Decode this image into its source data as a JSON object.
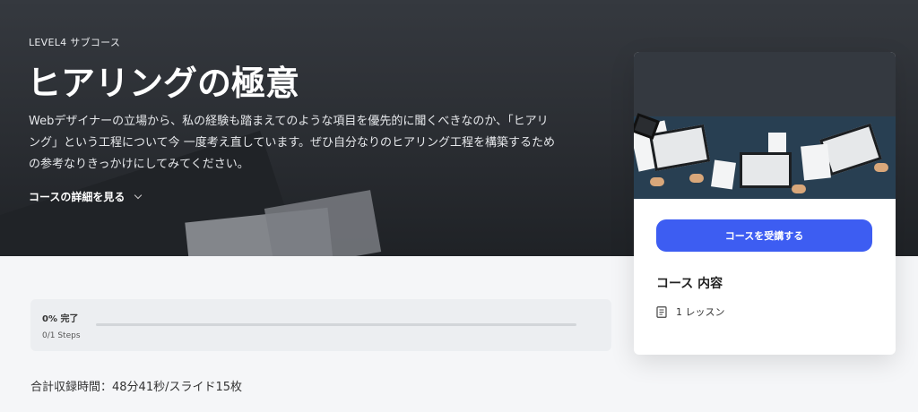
{
  "hero": {
    "level": "LEVEL4 サブコース",
    "title": "ヒアリングの極意",
    "description": "Webデザイナーの立場から、私の経験も踏まえてのような項目を優先的に聞くべきなのか、「ヒアリング」という工程について今 一度考え直しています。ぜひ自分なりのヒアリング工程を構築するための参考なりきっかけにしてみてください。",
    "detail_link": "コースの詳細を見る"
  },
  "progress": {
    "percent_label": "0% 完了",
    "percent": 0,
    "steps_label": "0/1 Steps"
  },
  "total_time": "合計収録時間：48分41秒/スライド15枚",
  "card": {
    "enroll_button": "コースを受講する",
    "content_heading": "コース 内容",
    "lesson_count": "1 レッスン",
    "accent_color": "#3d5df2"
  }
}
